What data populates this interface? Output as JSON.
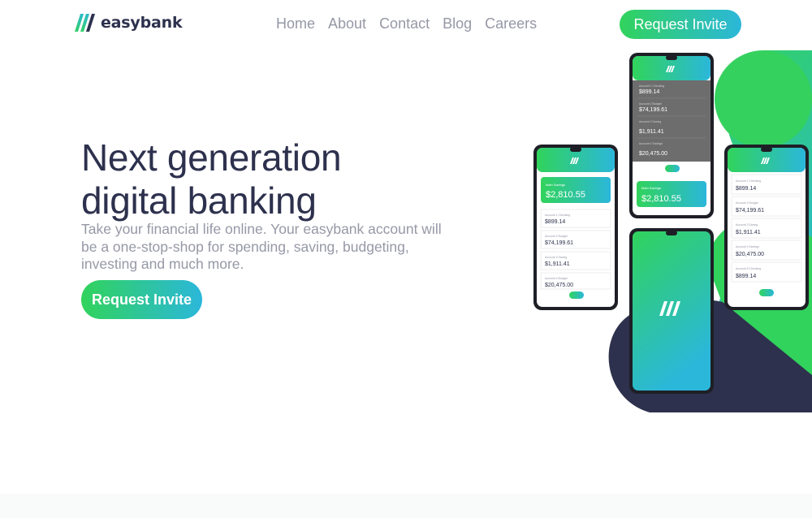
{
  "brand": {
    "name": "easybank"
  },
  "nav": {
    "items": [
      {
        "label": "Home"
      },
      {
        "label": "About"
      },
      {
        "label": "Contact"
      },
      {
        "label": "Blog"
      },
      {
        "label": "Careers"
      }
    ]
  },
  "header": {
    "cta_label": "Request Invite"
  },
  "hero": {
    "title_line1": "Next generation",
    "title_line2": "digital banking",
    "subtitle": "Take your financial life online. Your easybank account will be a one-stop-shop for spending, saving, budgeting, investing and much more.",
    "cta_label": "Request Invite"
  },
  "phones": {
    "left": {
      "card_label": "Main Savings",
      "card_balance": "$2,810.55",
      "rows": [
        {
          "label": "Account 1 Checking",
          "value": "$899.14"
        },
        {
          "label": "Account 2 Budget",
          "value": "$74,199.61"
        },
        {
          "label": "Account 3 Saving",
          "value": "$1,911.41"
        },
        {
          "label": "Account 4 Budget",
          "value": "$20,475.00"
        }
      ]
    },
    "top": {
      "rows": [
        {
          "label": "Account 1 Checking",
          "value": "$899.14"
        },
        {
          "label": "Account 2 Budget",
          "value": "$74,199.61"
        },
        {
          "label": "Account 3 Saving",
          "value": "$1,911.41"
        },
        {
          "label": "Account 4 Savings",
          "value": "$20,475.00"
        }
      ],
      "card_label": "Main Savings",
      "card_balance": "$2,810.55"
    },
    "right": {
      "rows": [
        {
          "label": "Account 1 Checking",
          "value": "$899.14"
        },
        {
          "label": "Account 2 Budget",
          "value": "$74,199.61"
        },
        {
          "label": "Account 3 Saving",
          "value": "$1,911.41"
        },
        {
          "label": "Account 4 Savings",
          "value": "$20,475.00"
        },
        {
          "label": "Account 5 Checking",
          "value": "$899.14"
        }
      ]
    }
  },
  "colors": {
    "primary_dark": "#2d314d",
    "green": "#31d35c",
    "cyan": "#2bb7da",
    "gray_text": "#9698a6"
  }
}
